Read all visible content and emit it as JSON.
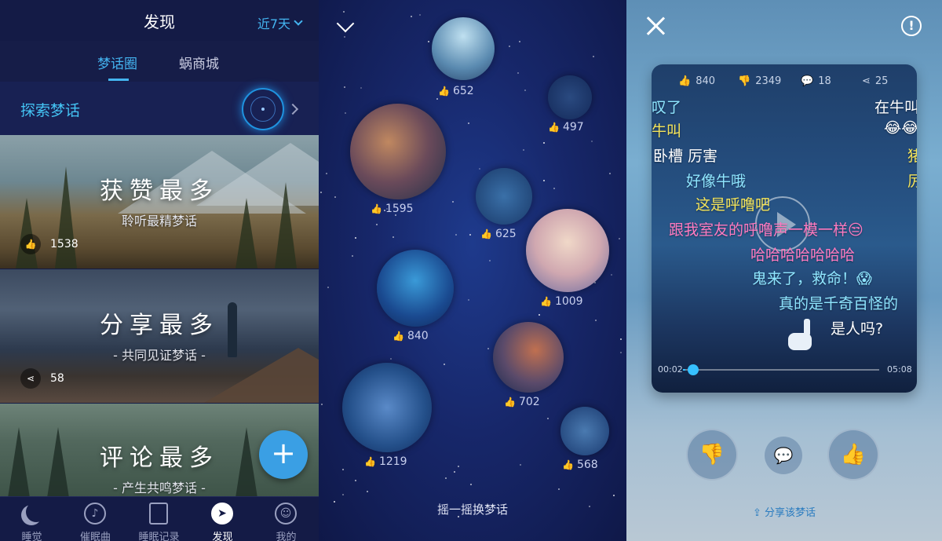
{
  "discover": {
    "title": "发现",
    "period": "近7天",
    "tabs": [
      {
        "label": "梦话圈",
        "active": true
      },
      {
        "label": "蜗商城",
        "active": false
      }
    ],
    "explore_label": "探索梦话",
    "cards": [
      {
        "title": "获赞最多",
        "subtitle": "聆听最精梦话",
        "count": "1538",
        "icon": "thumbs-up-icon"
      },
      {
        "title": "分享最多",
        "subtitle": "- 共同见证梦话 -",
        "count": "58",
        "icon": "share-icon"
      },
      {
        "title": "评论最多",
        "subtitle": "- 产生共鸣梦话 -"
      }
    ],
    "fab_label": "+",
    "tabbar": [
      {
        "label": "睡觉",
        "icon": "moon-icon"
      },
      {
        "label": "催眠曲",
        "icon": "music-note-icon"
      },
      {
        "label": "睡眠记录",
        "icon": "document-icon"
      },
      {
        "label": "发现",
        "icon": "compass-icon",
        "active": true
      },
      {
        "label": "我的",
        "icon": "smiley-icon"
      }
    ]
  },
  "explore": {
    "bubbles": [
      {
        "likes": "652"
      },
      {
        "likes": "497"
      },
      {
        "likes": "1595"
      },
      {
        "likes": "625"
      },
      {
        "likes": "1009"
      },
      {
        "likes": "840"
      },
      {
        "likes": "702"
      },
      {
        "likes": "1219"
      },
      {
        "likes": "568"
      }
    ],
    "shake_hint": "摇一摇换梦话"
  },
  "player": {
    "stats": {
      "likes": "840",
      "dislikes": "2349",
      "comments": "18",
      "shares": "25"
    },
    "danmaku": [
      "叹了",
      "在牛叫",
      "牛叫",
      "卧槽 厉害",
      "好像牛哦",
      "这是呼噜吧",
      "跟我室友的呼噜声一模一样😒",
      "哈哈哈哈哈哈哈",
      "鬼来了，救命！😱",
      "真的是千奇百怪的",
      "是人吗?"
    ],
    "emoji_right": "😂😂",
    "right_cut_1": "猪",
    "right_cut_2": "厉",
    "time_current": "00:02",
    "time_total": "05:08",
    "progress": 0.01,
    "share_label": "分享该梦话",
    "colors": {
      "accent": "#44b4f0",
      "dislike": "#2d8fe0",
      "like": "#e36aa0"
    }
  }
}
